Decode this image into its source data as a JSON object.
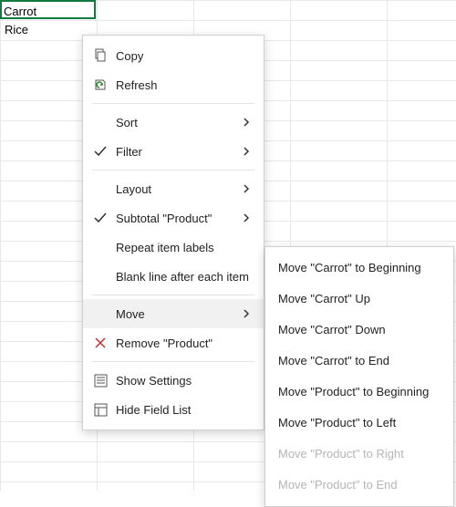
{
  "cells": {
    "selected": "Carrot",
    "row2": "Rice"
  },
  "menu": {
    "copy": "Copy",
    "refresh": "Refresh",
    "sort": "Sort",
    "filter": "Filter",
    "layout": "Layout",
    "subtotal": "Subtotal \"Product\"",
    "repeat": "Repeat item labels",
    "blankline": "Blank line after each item",
    "move": "Move",
    "remove": "Remove \"Product\"",
    "showsettings": "Show Settings",
    "hidefieldlist": "Hide Field List"
  },
  "submenu": {
    "to_beginning": "Move \"Carrot\" to Beginning",
    "up": "Move \"Carrot\" Up",
    "down": "Move \"Carrot\" Down",
    "to_end": "Move \"Carrot\" to End",
    "prod_beginning": "Move \"Product\" to Beginning",
    "prod_left": "Move \"Product\" to Left",
    "prod_right": "Move \"Product\" to Right",
    "prod_end": "Move \"Product\" to End"
  }
}
